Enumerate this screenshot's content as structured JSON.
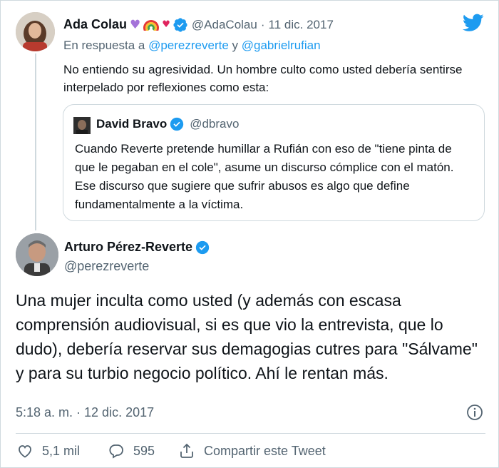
{
  "parent_tweet": {
    "display_name": "Ada Colau",
    "handle": "@AdaColau",
    "separator": "·",
    "date": "11 dic. 2017",
    "reply_prefix": "En respuesta a",
    "reply_user1": "@perezreverte",
    "reply_joiner": "y",
    "reply_user2": "@gabrielrufian",
    "text": "No entiendo su agresividad. Un hombre culto como usted debería sentirse interpelado por reflexiones como esta:",
    "quoted": {
      "display_name": "David Bravo",
      "handle": "@dbravo",
      "text": "Cuando Reverte pretende humillar a Rufián con eso de \"tiene pinta de que le pegaban en el cole\", asume un discurso cómplice con el matón. Ese discurso que sugiere que sufrir abusos es algo que define fundamentalmente a la víctima."
    }
  },
  "main_tweet": {
    "display_name": "Arturo Pérez-Reverte",
    "handle": "@perezreverte",
    "text": "Una mujer inculta como usted (y además con escasa comprensión audiovisual, si es que vio la entrevista, que lo dudo), debería reservar sus demagogias cutres para \"Sálvame\" y para su turbio negocio político. Ahí le rentan más.",
    "timestamp": "5:18 a. m. · 12 dic. 2017",
    "likes": "5,1 mil",
    "replies": "595",
    "share_label": "Compartir este Tweet"
  },
  "icons": {
    "brand": "twitter-bird-icon",
    "verified": "verified-badge-icon",
    "info": "info-icon",
    "like": "heart-icon",
    "reply": "reply-bubble-icon",
    "share": "share-icon"
  },
  "colors": {
    "brand_blue": "#1d9bf0",
    "text": "#0f1419",
    "muted": "#536471",
    "border": "#cfd9de"
  }
}
